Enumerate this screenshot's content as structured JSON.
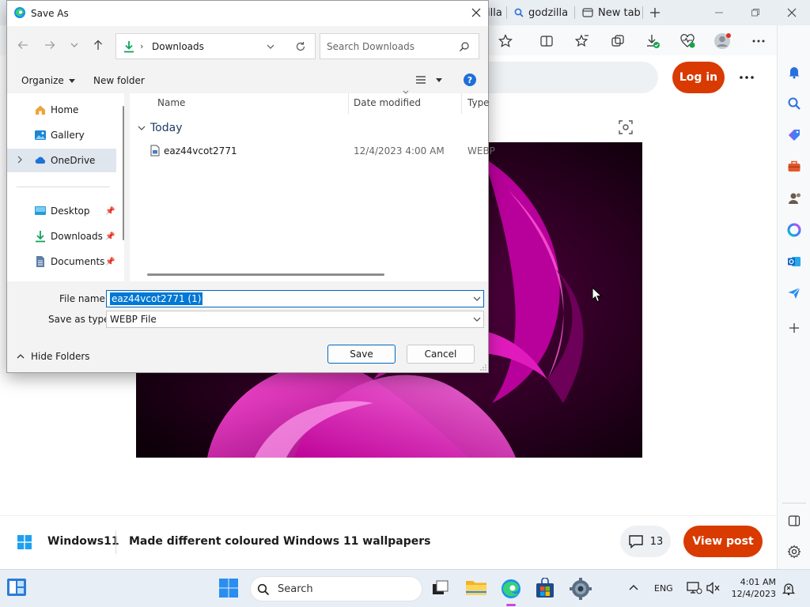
{
  "browser": {
    "tabs": [
      {
        "label": "illa"
      },
      {
        "label": "godzilla"
      },
      {
        "label": "New tab"
      }
    ],
    "login_label": "Log in",
    "post": {
      "community": "Windows11",
      "title": "Made different coloured Windows 11 wallpapers",
      "comment_count": "13",
      "view_label": "View post"
    }
  },
  "dialog": {
    "title": "Save As",
    "address": {
      "location": "Downloads"
    },
    "search_placeholder": "Search Downloads",
    "organize_label": "Organize",
    "new_folder_label": "New folder",
    "nav_items": [
      {
        "label": "Home"
      },
      {
        "label": "Gallery"
      },
      {
        "label": "OneDrive"
      },
      {
        "label": "Desktop"
      },
      {
        "label": "Downloads"
      },
      {
        "label": "Documents"
      }
    ],
    "columns": {
      "name": "Name",
      "date": "Date modified",
      "type": "Type"
    },
    "group_label": "Today",
    "files": [
      {
        "name": "eaz44vcot2771",
        "date": "12/4/2023 4:00 AM",
        "type": "WEBP"
      }
    ],
    "file_name_label": "File name:",
    "file_name_value": "eaz44vcot2771 (1)",
    "save_type_label": "Save as type:",
    "save_type_value": "WEBP File",
    "hide_folders_label": "Hide Folders",
    "save_label": "Save",
    "cancel_label": "Cancel"
  },
  "taskbar": {
    "search_label": "Search",
    "language": "ENG",
    "time": "4:01 AM",
    "date": "12/4/2023"
  },
  "colors": {
    "accent_blue": "#0067c0",
    "reddit_orange": "#d93a00",
    "selection": "#0078d4"
  }
}
